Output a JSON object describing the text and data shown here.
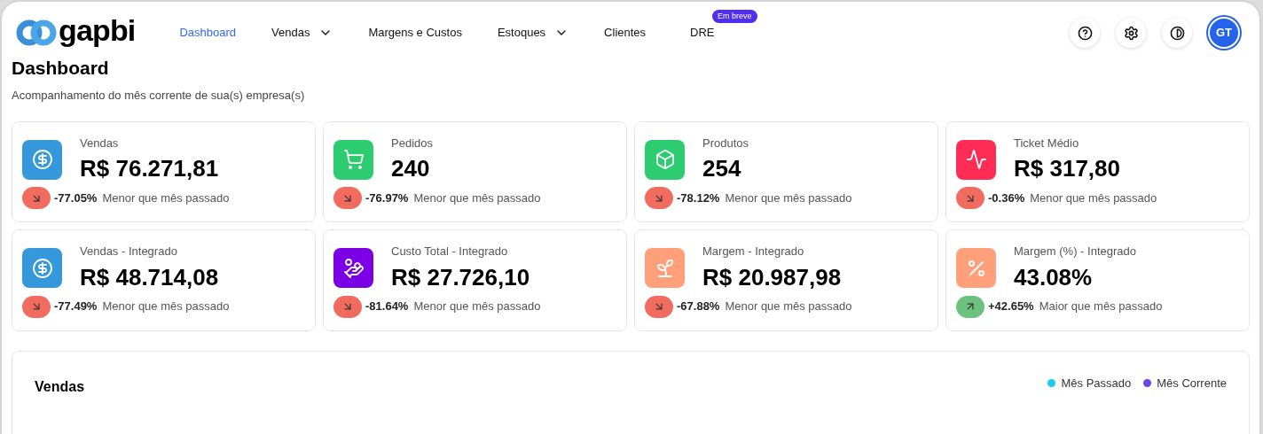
{
  "logo": {
    "text": "gapbi"
  },
  "nav": [
    {
      "label": "Dashboard",
      "selected": true,
      "dropdown": false
    },
    {
      "label": "Vendas",
      "selected": false,
      "dropdown": true
    },
    {
      "label": "Margens e Custos",
      "selected": false,
      "dropdown": false
    },
    {
      "label": "Estoques",
      "selected": false,
      "dropdown": true
    },
    {
      "label": "Clientes",
      "selected": false,
      "dropdown": false
    },
    {
      "label": "DRE",
      "selected": false,
      "dropdown": false,
      "badge": "Em breve"
    }
  ],
  "avatar": {
    "initials": "GT"
  },
  "page": {
    "title": "Dashboard",
    "subtitle": "Acompanhamento do mês corrente de sua(s) empresa(s)"
  },
  "cards": [
    {
      "label": "Vendas",
      "value": "R$ 76.271,81",
      "change": "-77.05%",
      "kind": "down",
      "note": "Menor que mês passado",
      "color": "#3498db"
    },
    {
      "label": "Pedidos",
      "value": "240",
      "change": "-76.97%",
      "kind": "down",
      "note": "Menor que mês passado",
      "color": "#2ecc71"
    },
    {
      "label": "Produtos",
      "value": "254",
      "change": "-78.12%",
      "kind": "down",
      "note": "Menor que mês passado",
      "color": "#2ecc71"
    },
    {
      "label": "Ticket Médio",
      "value": "R$ 317,80",
      "change": "-0.36%",
      "kind": "down",
      "note": "Menor que mês passado",
      "color": "#ff2d55"
    },
    {
      "label": "Vendas - Integrado",
      "value": "R$ 48.714,08",
      "change": "-77.49%",
      "kind": "down",
      "note": "Menor que mês passado",
      "color": "#3498db"
    },
    {
      "label": "Custo Total - Integrado",
      "value": "R$ 27.726,10",
      "change": "-81.64%",
      "kind": "down",
      "note": "Menor que mês passado",
      "color": "#7b00e6"
    },
    {
      "label": "Margem - Integrado",
      "value": "R$ 20.987,98",
      "change": "-67.88%",
      "kind": "down",
      "note": "Menor que mês passado",
      "color": "#ffa07a"
    },
    {
      "label": "Margem (%) - Integrado",
      "value": "43.08%",
      "change": "+42.65%",
      "kind": "up",
      "note": "Maior que mês passado",
      "color": "#ffa07a"
    }
  ],
  "sales_panel": {
    "title": "Vendas",
    "legend": [
      {
        "label": "Mês Passado",
        "color": "#1ccbf0"
      },
      {
        "label": "Mês Corrente",
        "color": "#6a45ee"
      }
    ]
  }
}
